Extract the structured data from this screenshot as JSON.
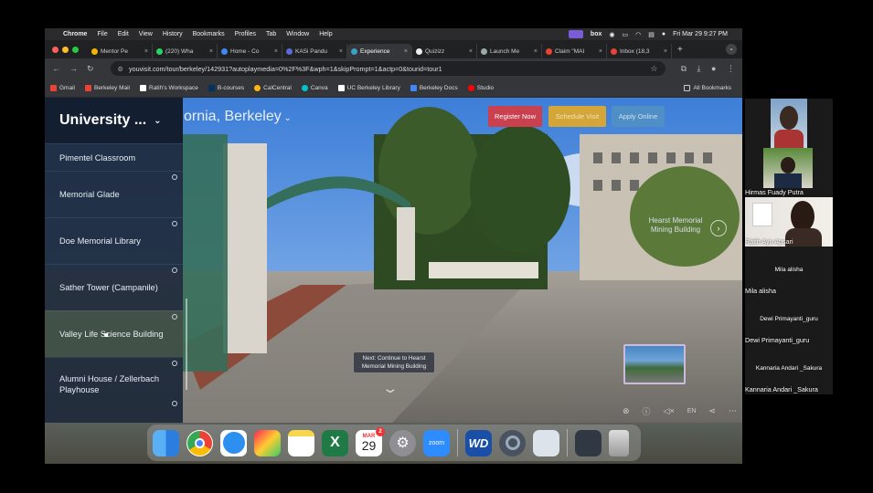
{
  "menubar": {
    "app": "Chrome",
    "items": [
      "File",
      "Edit",
      "View",
      "History",
      "Bookmarks",
      "Profiles",
      "Tab",
      "Window",
      "Help"
    ],
    "right_text": "box",
    "clock": "Fri Mar 29  9:27 PM"
  },
  "tabs": [
    {
      "label": "Mentor Pe"
    },
    {
      "label": "(220) Wha"
    },
    {
      "label": "Home - Co"
    },
    {
      "label": "KASi Pandu"
    },
    {
      "label": "Experience",
      "active": true
    },
    {
      "label": "Quizizz"
    },
    {
      "label": "Launch Me"
    },
    {
      "label": "Claim \"MAI"
    },
    {
      "label": "Inbox (18,3"
    }
  ],
  "address": {
    "url": "youvisit.com/tour/berkeley/142931?autoplaymedia=0%2F%3F&wph=1&skipPrompt=1&actp=0&tourid=tour1"
  },
  "bookmarks": [
    {
      "label": "Gmail",
      "color": "#ea4335"
    },
    {
      "label": "Berkeley Mail",
      "color": "#ea4335"
    },
    {
      "label": "Ratih's Workspace",
      "color": "#ffffff"
    },
    {
      "label": "B-courses",
      "color": "#003262"
    },
    {
      "label": "CalCentral",
      "color": "#fdb515"
    },
    {
      "label": "Canva",
      "color": "#00c4cc"
    },
    {
      "label": "UC Berkeley Library",
      "color": "#ffffff"
    },
    {
      "label": "Berkeley Docs",
      "color": "#4285f4"
    },
    {
      "label": "Studio",
      "color": "#ff0000"
    }
  ],
  "bookmarks_all": "All Bookmarks",
  "tour": {
    "sidebar_title": "University ...",
    "location_title": "ornia, Berkeley",
    "locations": [
      "Pimentel Classroom",
      "Memorial Glade",
      "Doe Memorial Library",
      "Sather Tower (Campanile)",
      "Valley Life Science Building",
      "Alumni House / Zellerbach Playhouse"
    ],
    "selected_index": 4,
    "cta": {
      "register": "Register Now",
      "schedule": "Schedule Visit",
      "apply": "Apply Online"
    },
    "hotspot": "Hearst Memorial Mining Building",
    "next_prompt": "Next: Continue to Hearst Memorial Mining Building",
    "lang": "EN"
  },
  "dock": {
    "calendar_month": "MAR",
    "calendar_day": "29",
    "calendar_badge": "2",
    "zoom_label": "zoom",
    "wd_label": "WD"
  },
  "participants": [
    {
      "name": "",
      "type": "video"
    },
    {
      "name": "Hirmas Fuady Putra",
      "type": "video"
    },
    {
      "name": "Ratih Ayu Apsari",
      "type": "video"
    },
    {
      "name": "Mila alisha",
      "type": "name"
    },
    {
      "name": "Dewi Primayanti_guru",
      "type": "name"
    },
    {
      "name": "Kannaria Andari _Sakura",
      "type": "name"
    }
  ],
  "colors": {
    "register": "#c9414f",
    "schedule": "#d4a63a",
    "apply": "#4f8fc6"
  }
}
